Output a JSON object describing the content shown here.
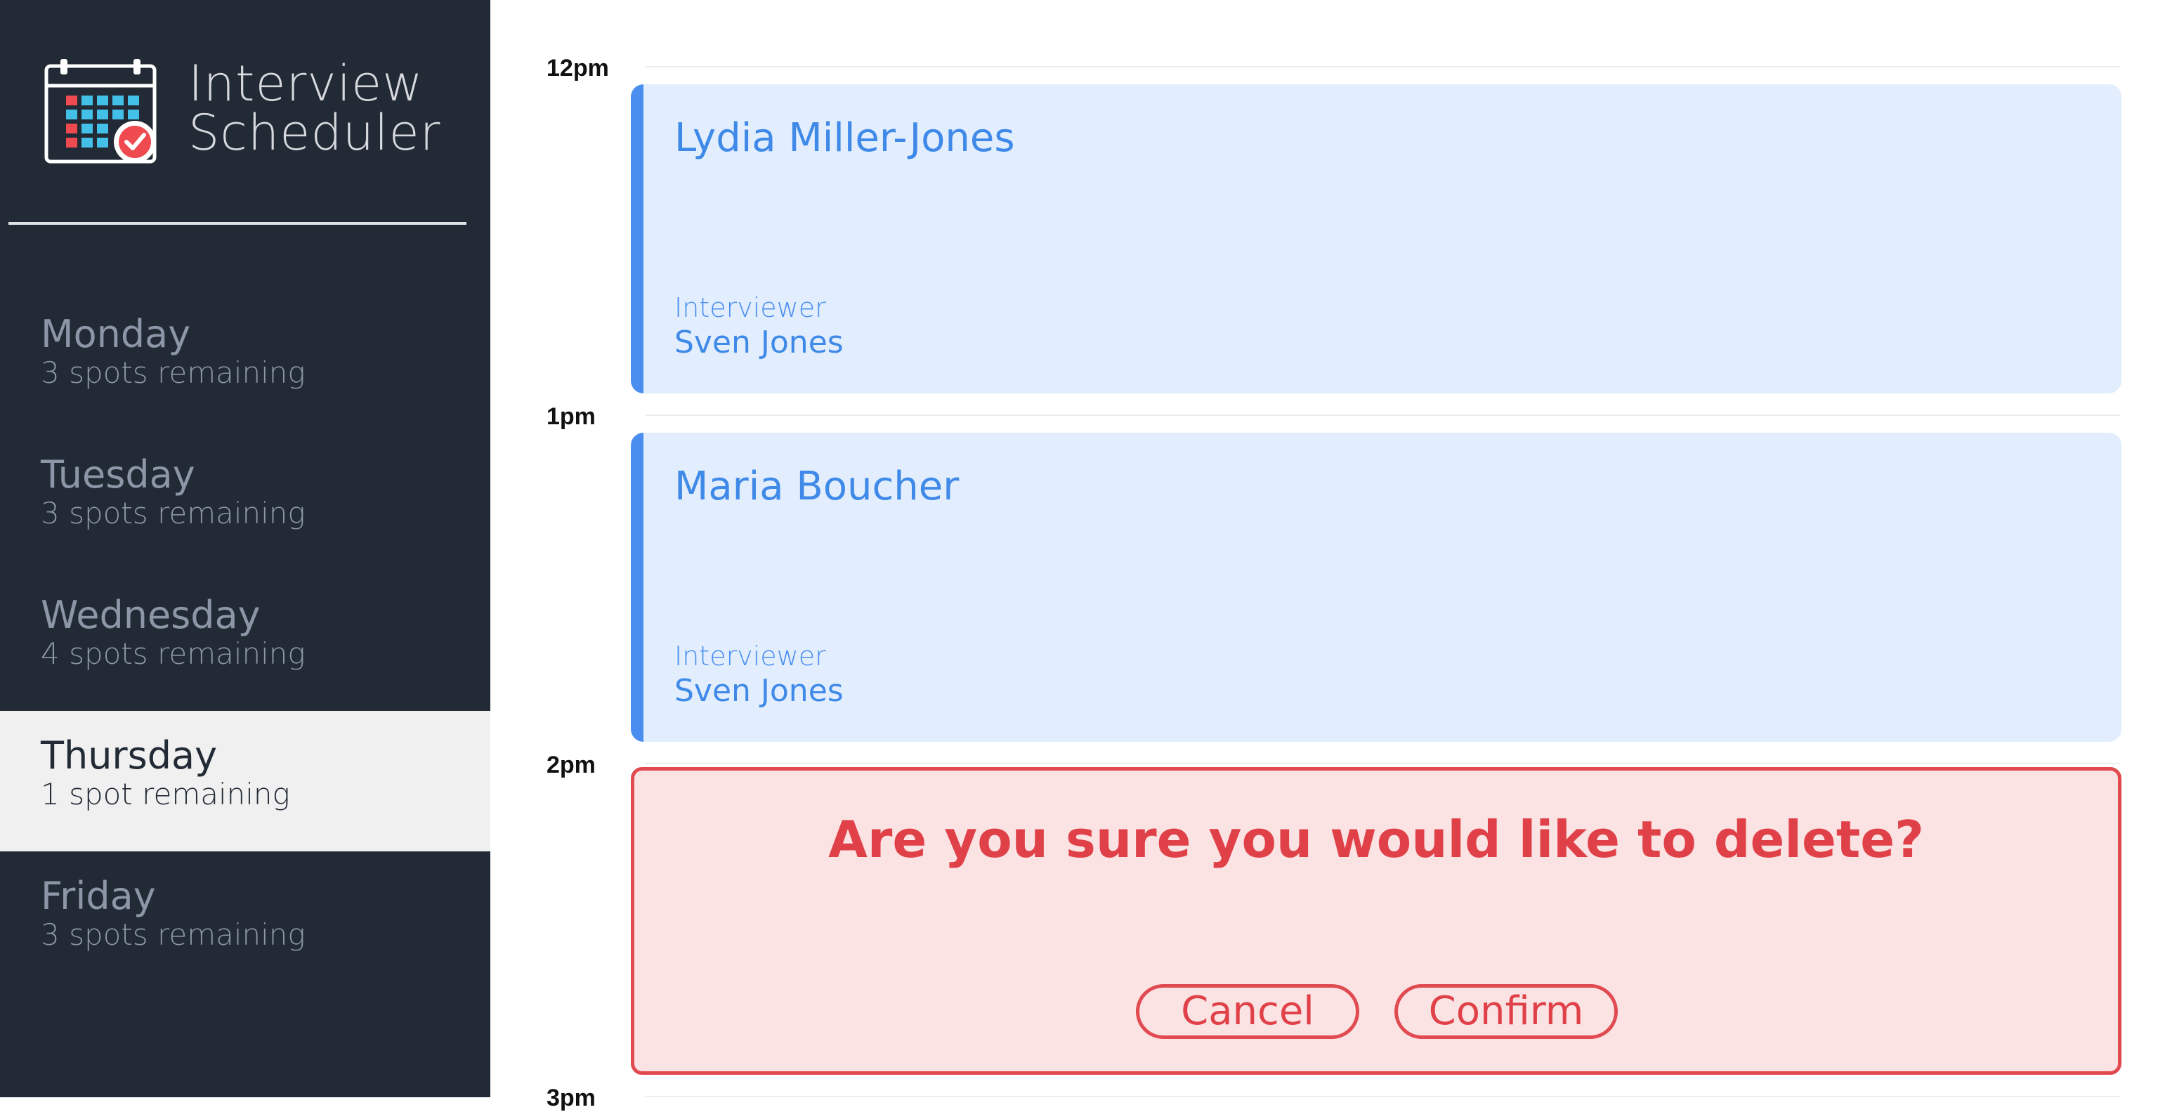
{
  "app": {
    "title": "Interview\nScheduler",
    "logo_icon": "calendar-check-icon"
  },
  "sidebar": {
    "days": [
      {
        "name": "Monday",
        "spots": "3 spots remaining",
        "selected": false
      },
      {
        "name": "Tuesday",
        "spots": "3 spots remaining",
        "selected": false
      },
      {
        "name": "Wednesday",
        "spots": "4 spots remaining",
        "selected": false
      },
      {
        "name": "Thursday",
        "spots": "1 spot remaining",
        "selected": true
      },
      {
        "name": "Friday",
        "spots": "3 spots remaining",
        "selected": false
      }
    ]
  },
  "schedule": {
    "times": [
      "12pm",
      "1pm",
      "2pm",
      "3pm"
    ],
    "appointments": [
      {
        "student": "Lydia Miller-Jones",
        "interviewer_label": "Interviewer",
        "interviewer": "Sven Jones"
      },
      {
        "student": "Maria Boucher",
        "interviewer_label": "Interviewer",
        "interviewer": "Sven Jones"
      }
    ],
    "confirm": {
      "message": "Are you sure you would like to delete?",
      "cancel_label": "Cancel",
      "confirm_label": "Confirm"
    }
  },
  "colors": {
    "sidebar_bg": "#222a36",
    "selected_bg": "#f0f0f0",
    "appointment_bg": "#e2eefd",
    "appointment_accent": "#4a8ff0",
    "danger": "#e04148",
    "danger_bg": "#fbe2e3"
  }
}
